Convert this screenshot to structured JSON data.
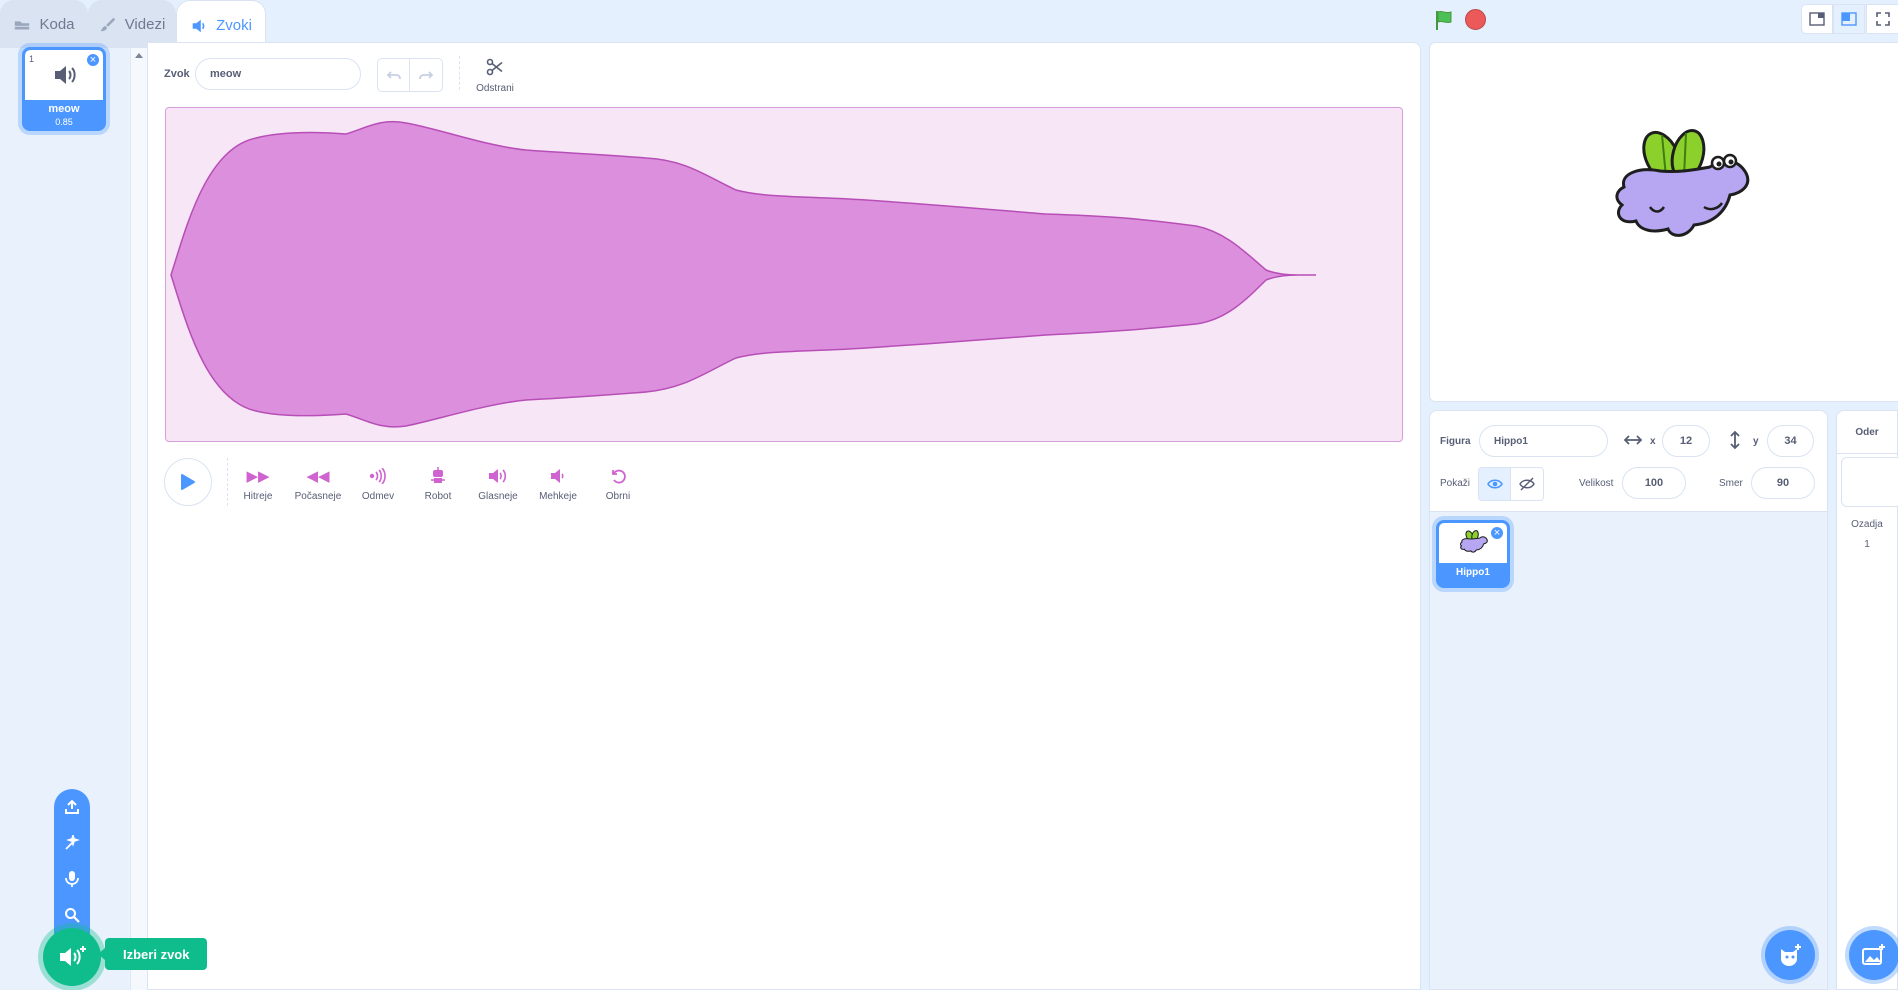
{
  "tabs": [
    {
      "label": "Koda",
      "icon": "code-icon"
    },
    {
      "label": "Videzi",
      "icon": "brush-icon"
    },
    {
      "label": "Zvoki",
      "icon": "speaker-icon"
    }
  ],
  "sound_list": {
    "items": [
      {
        "index": "1",
        "name": "meow",
        "duration": "0.85"
      }
    ]
  },
  "editor": {
    "sound_label": "Zvok",
    "sound_name": "meow",
    "delete_label": "Odstrani",
    "effects": [
      {
        "label": "Hitreje",
        "icon": "faster-icon"
      },
      {
        "label": "Počasneje",
        "icon": "slower-icon"
      },
      {
        "label": "Odmev",
        "icon": "echo-icon"
      },
      {
        "label": "Robot",
        "icon": "robot-icon"
      },
      {
        "label": "Glasneje",
        "icon": "louder-icon"
      },
      {
        "label": "Mehkeje",
        "icon": "softer-icon"
      },
      {
        "label": "Obrni",
        "icon": "reverse-icon"
      }
    ]
  },
  "sprite_info": {
    "sprite_label": "Figura",
    "sprite_name": "Hippo1",
    "x_label": "x",
    "x_value": "12",
    "y_label": "y",
    "y_value": "34",
    "show_label": "Pokaži",
    "size_label": "Velikost",
    "size_value": "100",
    "direction_label": "Smer",
    "direction_value": "90"
  },
  "sprites": [
    {
      "name": "Hippo1"
    }
  ],
  "stage_panel": {
    "title": "Oder",
    "backdrops_label": "Ozadja",
    "backdrops_count": "1"
  },
  "tooltip": {
    "choose_sound": "Izberi zvok"
  },
  "colors": {
    "accent": "#4c97ff",
    "sound_wave": "#cf63cf",
    "green": "#0fbd8c",
    "flag": "#4cbf56",
    "stop": "#ec5959"
  }
}
